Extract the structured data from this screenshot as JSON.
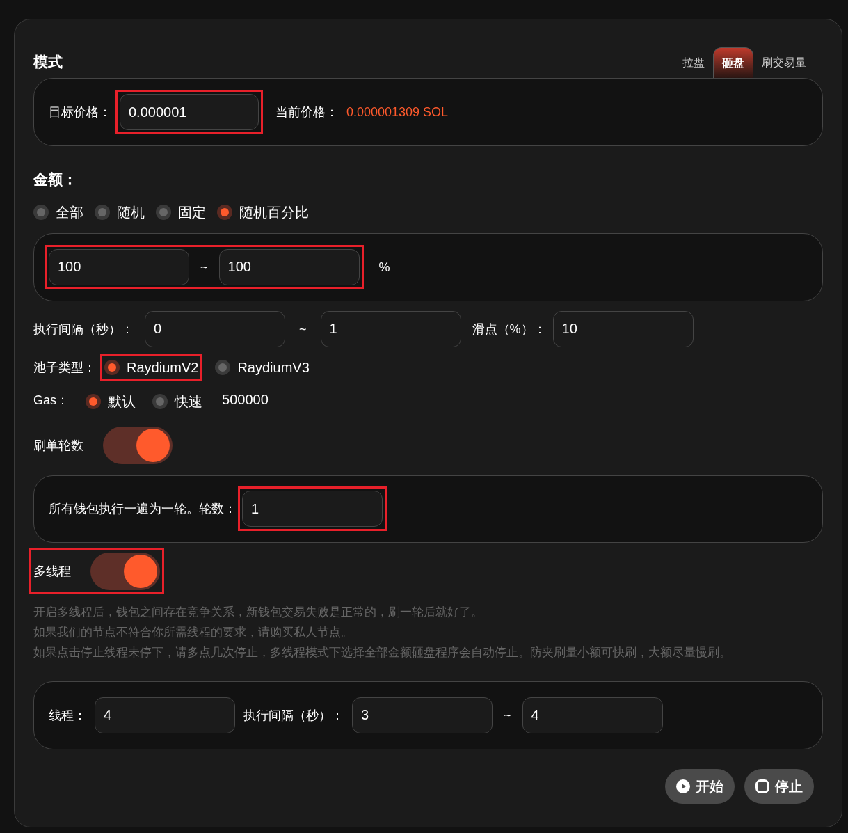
{
  "mode": {
    "title": "模式",
    "tabs": [
      {
        "label": "拉盘",
        "selected": false
      },
      {
        "label": "砸盘",
        "selected": true
      },
      {
        "label": "刷交易量",
        "selected": false
      }
    ]
  },
  "target_price": {
    "label": "目标价格：",
    "value": "0.000001",
    "highlighted": true
  },
  "current_price": {
    "label": "当前价格：",
    "value": "0.000001309 SOL"
  },
  "amount": {
    "title": "金额：",
    "options": [
      {
        "label": "全部",
        "selected": false
      },
      {
        "label": "随机",
        "selected": false
      },
      {
        "label": "固定",
        "selected": false
      },
      {
        "label": "随机百分比",
        "selected": true
      }
    ],
    "range": {
      "min": "100",
      "separator": "~",
      "max": "100",
      "unit": "%",
      "highlighted": true
    }
  },
  "interval": {
    "label": "执行间隔（秒）：",
    "min": "0",
    "separator": "~",
    "max": "1"
  },
  "slippage": {
    "label": "滑点（%）：",
    "value": "10"
  },
  "pool_type": {
    "label": "池子类型：",
    "options": [
      {
        "label": "RaydiumV2",
        "selected": true,
        "highlighted": true
      },
      {
        "label": "RaydiumV3",
        "selected": false,
        "highlighted": false
      }
    ]
  },
  "gas": {
    "label": "Gas：",
    "options": [
      {
        "label": "默认",
        "selected": true
      },
      {
        "label": "快速",
        "selected": false
      }
    ],
    "value": "500000"
  },
  "rounds": {
    "label": "刷单轮数",
    "on": true,
    "description": "所有钱包执行一遍为一轮。轮数：",
    "value": "1",
    "highlighted": true
  },
  "multithread": {
    "label": "多线程",
    "on": true,
    "highlighted": true,
    "notes": [
      "开启多线程后，钱包之间存在竞争关系，新钱包交易失败是正常的，刷一轮后就好了。",
      "如果我们的节点不符合你所需线程的要求，请购买私人节点。",
      "如果点击停止线程未停下，请多点几次停止，多线程模式下选择全部金额砸盘程序会自动停止。防夹刷量小额可快刷，大额尽量慢刷。"
    ],
    "threads_label": "线程：",
    "threads": "4",
    "interval_label": "执行间隔（秒）：",
    "interval_min": "3",
    "separator": "~",
    "interval_max": "4"
  },
  "buttons": [
    {
      "kind": "start",
      "label": "开始"
    },
    {
      "kind": "stop",
      "label": "停止"
    }
  ]
}
